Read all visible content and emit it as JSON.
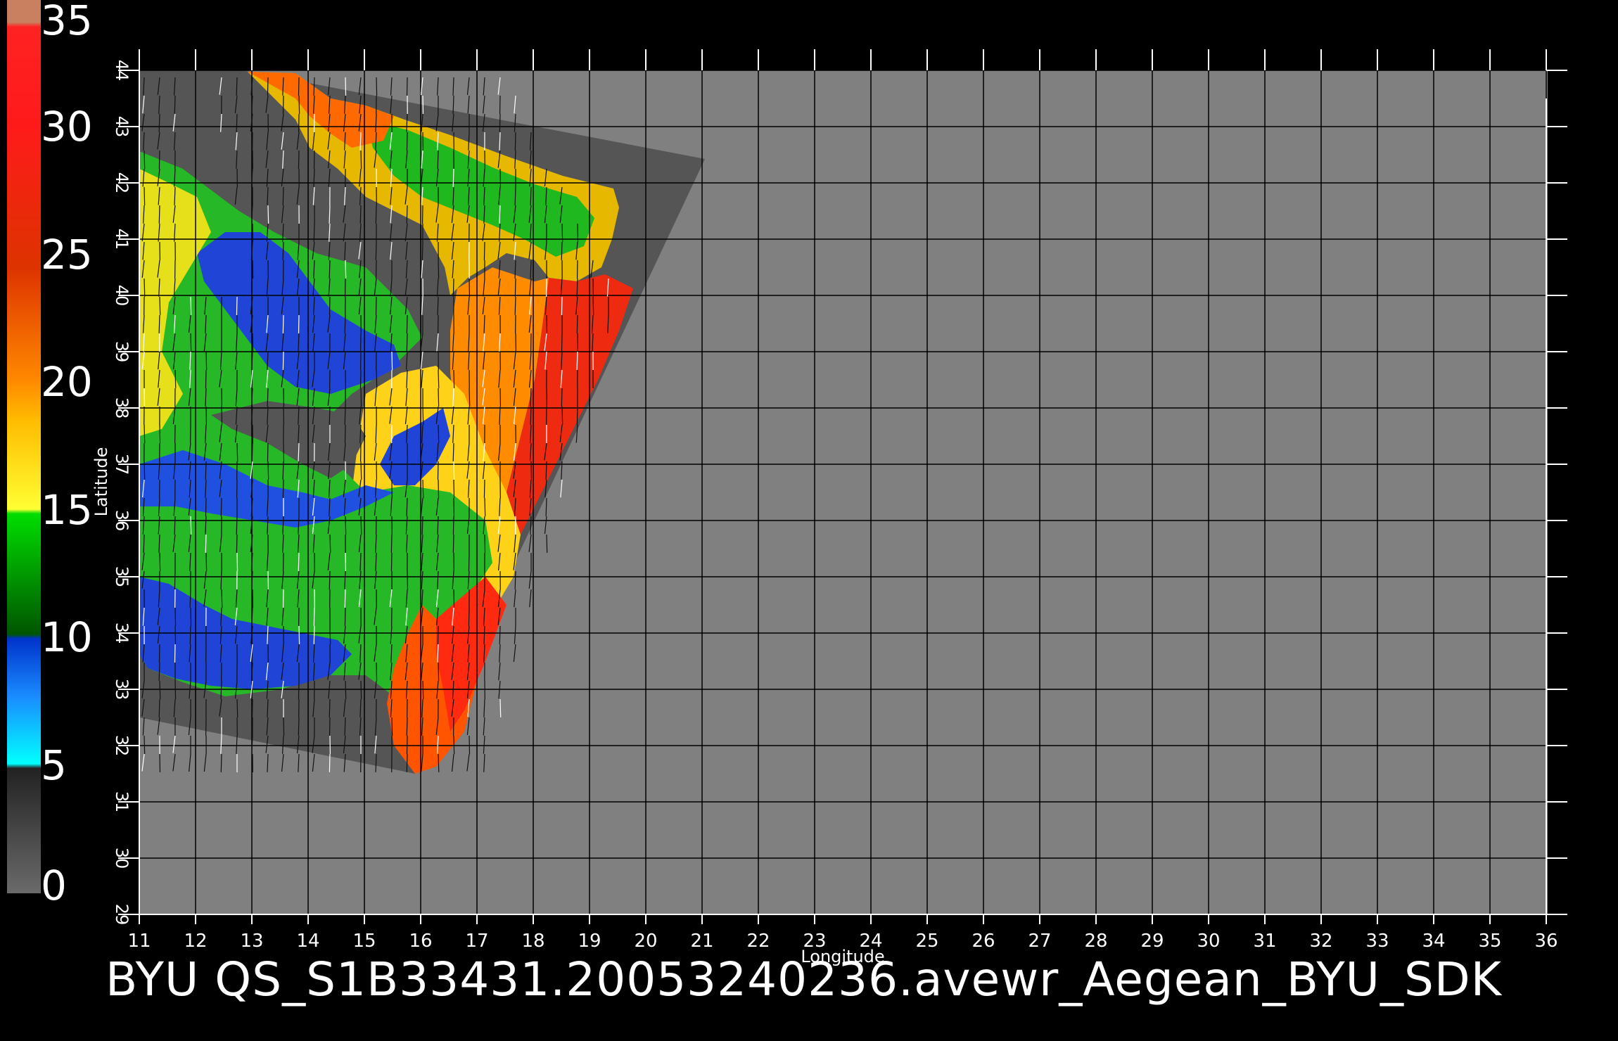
{
  "map": {
    "xlabel": "Longitude",
    "ylabel": "Latitude",
    "lon_ticks": [
      "11",
      "12",
      "13",
      "14",
      "15",
      "16",
      "17",
      "18",
      "19",
      "20",
      "21",
      "22",
      "23",
      "24",
      "25",
      "26",
      "27",
      "28",
      "29",
      "30",
      "31",
      "32",
      "33",
      "34",
      "35",
      "36"
    ],
    "lat_ticks": [
      "29",
      "30",
      "31",
      "32",
      "33",
      "34",
      "35",
      "36",
      "37",
      "38",
      "39",
      "40",
      "41",
      "42",
      "43",
      "44"
    ],
    "lon_range": [
      11,
      36
    ],
    "lat_range": [
      29,
      44
    ],
    "grid": true
  },
  "colorbar": {
    "labels": [
      "0",
      "5",
      "10",
      "15",
      "20",
      "25",
      "30",
      "35"
    ],
    "range": [
      0,
      35
    ]
  },
  "footer": {
    "text": "BYU QS_S1B33431.20053240236.avewr_Aegean_BYU_SDK"
  },
  "colors": {
    "background": "#000000",
    "land_fill": "#808080",
    "swath_fill": "#555555",
    "grid": "#000000"
  }
}
